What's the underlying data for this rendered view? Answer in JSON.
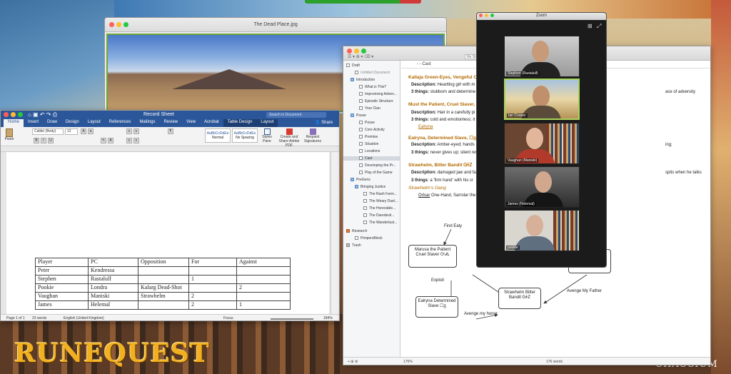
{
  "desktop": {
    "brand_logo": "RUNEQUEST",
    "publisher_logo": "CHAOSIUM"
  },
  "preview_window": {
    "title": "The Dead Place.jpg"
  },
  "word": {
    "title": "Record Sheet",
    "search_placeholder": "Search in Document",
    "tabs": [
      "Home",
      "Insert",
      "Draw",
      "Design",
      "Layout",
      "References",
      "Mailings",
      "Review",
      "View",
      "Acrobat",
      "Table Design",
      "Layout"
    ],
    "active_tab_index": 0,
    "share_label": "Share",
    "ribbon": {
      "paste_label": "Paste",
      "font_name": "Calibri (Body)",
      "font_size": "12",
      "style_normal": "Normal",
      "style_no_spacing": "No Spacing",
      "styles_pane_label": "Styles Pane",
      "create_pdf_label": "Create and Share Adobe PDF",
      "request_signatures_label": "Request Signatures"
    },
    "status": {
      "page": "Page 1 of 1",
      "words": "23 words",
      "language": "English (United Kingdom)",
      "focus": "Focus",
      "zoom": "184%"
    },
    "table": {
      "headers": [
        "Player",
        "PC",
        "Opposition",
        "For",
        "Against"
      ],
      "rows": [
        [
          "Peter",
          "Kendressa",
          "",
          "",
          ""
        ],
        [
          "Stephen",
          "Rastalulf",
          "",
          "1",
          ""
        ],
        [
          "Pookie",
          "Londra",
          "Kalarg Dead-Shot",
          "",
          "2"
        ],
        [
          "Vaughan",
          "Maniski",
          "Strawhelm",
          "2",
          ""
        ],
        [
          "James",
          "Helemal",
          "",
          "2",
          "1"
        ]
      ]
    }
  },
  "scrivener": {
    "binder": [
      "Draft",
      "Untitled Document",
      "Introduction",
      "What is This?",
      "Improvising Adven...",
      "Episode Structure",
      "Your Clan",
      "Posse",
      "Posse",
      "Core Activity",
      "Premise",
      "Situation",
      "Locations",
      "Cast",
      "Developing the Pr...",
      "Play of the Game",
      "PreGens",
      "Bringing Justice",
      "The Rash Farm...",
      "The Weary Duel...",
      "The Honorable...",
      "The Daredevil...",
      "The Wanderlust...",
      "Research",
      "PimpersBlock",
      "Trash"
    ],
    "selected_binder_index": 13,
    "style_label": "No Style",
    "doc_title": "Cast",
    "content": {
      "h1": "Kallaja Green-Eyes, Vengeful Ch",
      "h1_desc_label": "Description:",
      "h1_desc": "Heartling girl  with m",
      "h1_things_label": "3 things:",
      "h1_things": "stubborn and determine",
      "h1_things_tail": "ace of adversity",
      "h2": "Must the Patient, Cruel Slaver,",
      "h2_desc_label": "Description:",
      "h2_desc": "Hair in a carefully pi",
      "h2_things_label": "3 things:",
      "h2_things": "cold and emotionless; it",
      "h2_extra": "Ealryna",
      "h3": "Ealryna, Determined Slave, ☐ᵹ",
      "h3_desc_label": "Description:",
      "h3_desc": "Amber-eyed; hands",
      "h3_desc_tail": "ing;",
      "h3_things_label": "3 things:",
      "h3_things": "never gives up; silent res",
      "h4": "Strawhelm, Bitter Bandit ᏀᏐᏃ",
      "h4_desc_label": "Description:",
      "h4_desc": "damaged jaw and fa",
      "h4_desc_tail": "spits when he talks",
      "h4_things_label": "3 things",
      "h4_things": ":  a 'firm hand' with his cr",
      "gang_heading": "Strawhelm's Gang",
      "gang_item_name": "Orlsar",
      "gang_item_rest": "One-Hand, Sarrolar the"
    },
    "diagram": {
      "nodes": {
        "marusa": "Marusa the Patient Cruel Slaver ᏅᏗᏓ",
        "ealryna": "Ealryna Determined Slave ☐ᵹ",
        "strawhelm": "Strawhelm Bitter Bandit ᏀᏐᏃ",
        "kallaja": "...n-Eyes Child"
      },
      "edges": {
        "find": "Find Ealy",
        "exploit": "Exploit",
        "avenge_honor": "Avenge my honor",
        "avenge_father": "Avenge My Father"
      }
    },
    "footer": {
      "zoom": "175%",
      "word_count": "176 words"
    }
  },
  "zoom": {
    "title": "Zoom",
    "participants": [
      {
        "name": "Stephen (Rastalulf)",
        "active": false
      },
      {
        "name": "Ian Cooper",
        "active": true
      },
      {
        "name": "Vaughan (Maniski)",
        "active": false
      },
      {
        "name": "James (Helemal)",
        "active": false
      },
      {
        "name": "pookie",
        "active": false
      }
    ]
  }
}
